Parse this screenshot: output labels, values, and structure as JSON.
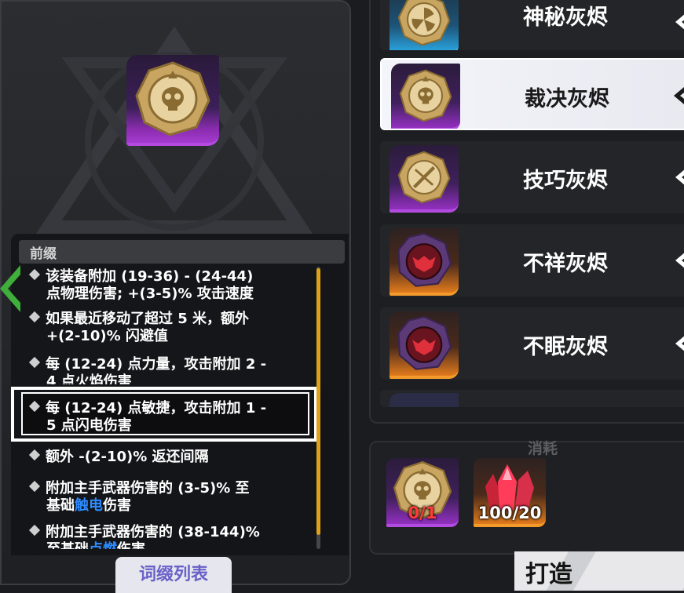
{
  "left_panel": {
    "prefix_title": "前缀",
    "affixes": [
      {
        "line1": "该装备附加 (19-36) - (24-44)",
        "line2": "点物理伤害; +(3-5)% 攻击速度"
      },
      {
        "line1": "如果最近移动了超过 5 米，额外",
        "line2": "+(2-10)% 闪避值"
      },
      {
        "line1": "每 (12-24) 点力量，攻击附加 2 -",
        "line2": "4 点火焰伤害"
      },
      {
        "line1": "每 (12-24) 点敏捷，攻击附加 1 -",
        "line2": "5 点闪电伤害"
      },
      {
        "line1": "额外 -(2-10)% 返还间隔",
        "line2": ""
      },
      {
        "line1": "附加主手武器伤害的 (3-5)% 至",
        "line2_pre": "基础",
        "line2_hl": "触电",
        "line2_post": "伤害"
      },
      {
        "line1": "附加主手武器伤害的 (38-144)%",
        "line2_pre": "至基础",
        "line2_hl": "点燃",
        "line2_post": "伤害"
      }
    ],
    "affix_list_button": "词缀列表"
  },
  "ember_list": [
    {
      "name": "神秘灰烬",
      "rarity": "blue",
      "icon": "fan-icon",
      "selected": false
    },
    {
      "name": "裁决灰烬",
      "rarity": "purple",
      "icon": "skull-icon",
      "selected": true
    },
    {
      "name": "技巧灰烬",
      "rarity": "purple",
      "icon": "crossed-swords-icon",
      "selected": false
    },
    {
      "name": "不祥灰烬",
      "rarity": "orange",
      "icon": "demon-icon",
      "selected": false
    },
    {
      "name": "不眠灰烬",
      "rarity": "orange",
      "icon": "demon-icon",
      "selected": false
    }
  ],
  "cost": {
    "title": "消耗",
    "items": [
      {
        "icon": "skull-icon",
        "count": "0/1",
        "insufficient": true
      },
      {
        "icon": "crystal-icon",
        "count": "100/20",
        "insufficient": false
      }
    ]
  },
  "craft_button": "打造"
}
